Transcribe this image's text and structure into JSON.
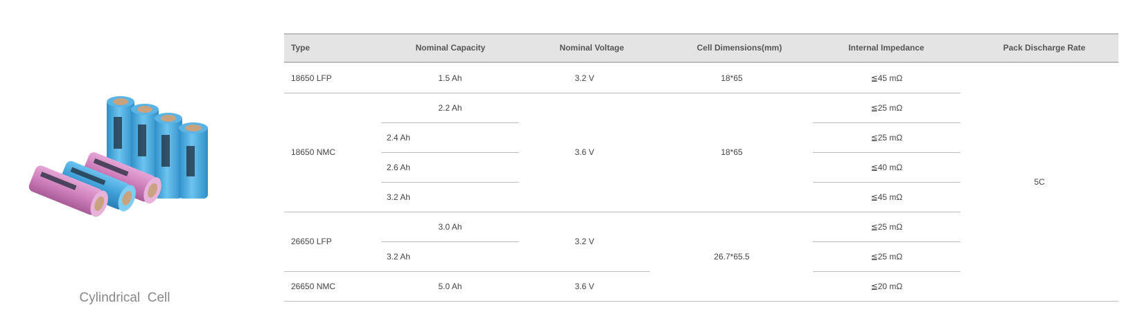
{
  "product": {
    "caption": "Cylindrical  Cell",
    "cell_colors": {
      "blue": "#4aaee3",
      "pink": "#d68ac3"
    }
  },
  "table": {
    "headers": {
      "type": "Type",
      "capacity": "Nominal Capacity",
      "voltage": "Nominal Voltage",
      "dimensions": "Cell Dimensions(mm)",
      "impedance": "Internal Impedance",
      "discharge": "Pack Discharge Rate"
    },
    "types": [
      "18650 LFP",
      "18650 NMC",
      "26650 LFP",
      "26650 NMC"
    ],
    "capacities": [
      "1.5 Ah",
      "2.2 Ah",
      "2.4 Ah",
      "2.6 Ah",
      "3.2 Ah",
      "3.0 Ah",
      "3.2 Ah",
      "5.0 Ah"
    ],
    "voltages": [
      "3.2 V",
      "3.6 V",
      "3.2 V",
      "3.6 V"
    ],
    "dimensions": [
      "18*65",
      "18*65",
      "26.7*65.5"
    ],
    "impedances": [
      "≦45 mΩ",
      "≦25 mΩ",
      "≦25 mΩ",
      "≦40 mΩ",
      "≦45 mΩ",
      "≦25 mΩ",
      "≦25 mΩ",
      "≦20 mΩ"
    ],
    "discharge_rate": "5C"
  }
}
